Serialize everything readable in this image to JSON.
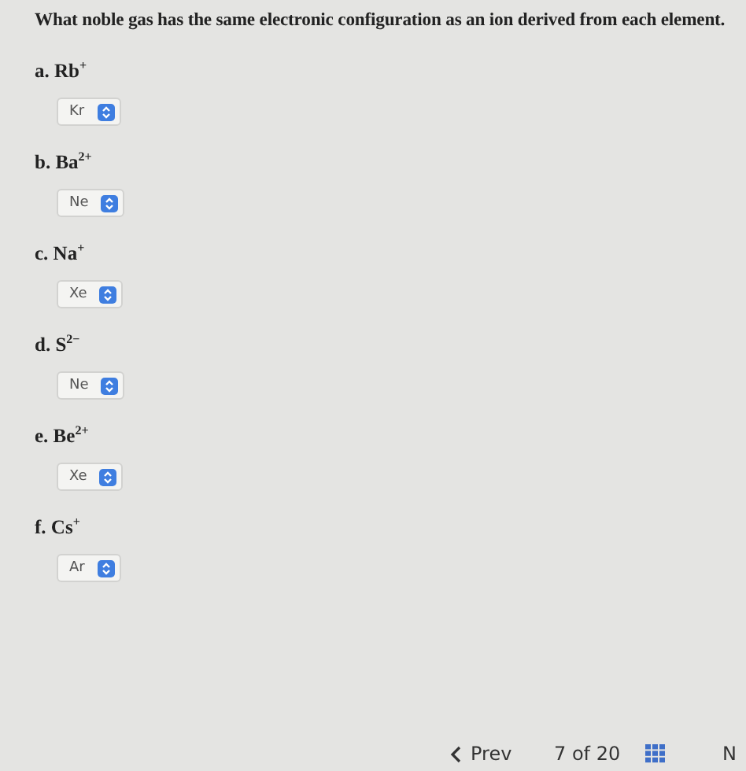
{
  "question": "What noble gas has the same electronic configuration as an ion derived from each element.",
  "items": [
    {
      "label": "a. Rb$^{+}$",
      "answer": "Kr"
    },
    {
      "label": "b. Ba$^{2+}$",
      "answer": "Ne"
    },
    {
      "label": "c. Na$^{+}$",
      "answer": "Xe"
    },
    {
      "label": "d. S$^{2−}$",
      "answer": "Ne"
    },
    {
      "label": "e. Be$^{2+}$",
      "answer": "Xe"
    },
    {
      "label": "f. Cs$^{+}$",
      "answer": "Ar"
    }
  ],
  "footer": {
    "prev": "Prev",
    "page": "7 of 20",
    "next": "N"
  }
}
